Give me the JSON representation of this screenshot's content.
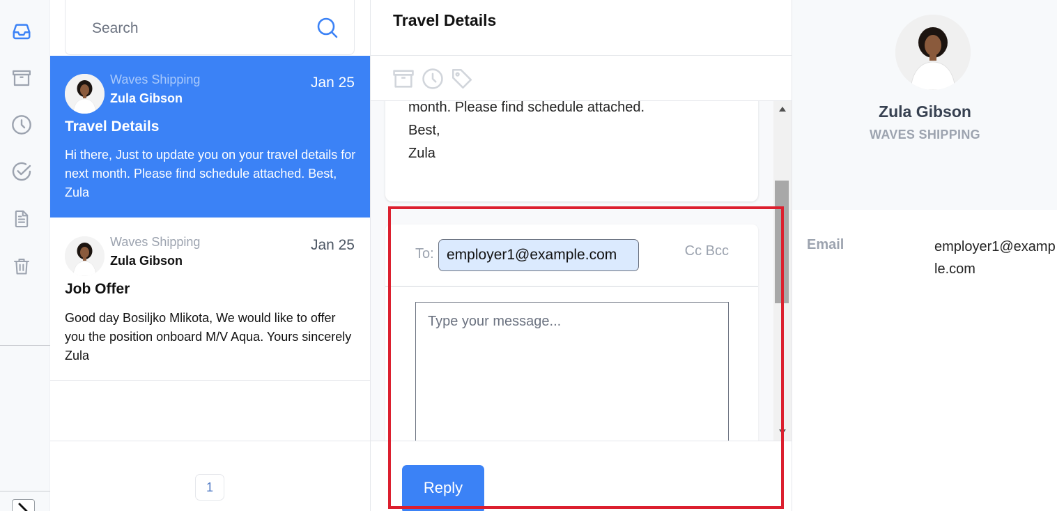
{
  "rail": {
    "items": [
      {
        "icon": "inbox-icon",
        "label": "Inbox",
        "active": true
      },
      {
        "icon": "archive-icon",
        "label": "Archive",
        "active": false
      },
      {
        "icon": "clock-icon",
        "label": "Snoozed",
        "active": false
      },
      {
        "icon": "check-circle-icon",
        "label": "Done",
        "active": false
      },
      {
        "icon": "document-icon",
        "label": "Drafts",
        "active": false
      },
      {
        "icon": "trash-icon",
        "label": "Trash",
        "active": false
      }
    ],
    "toggle_icon": "expand-arrow-icon"
  },
  "search": {
    "placeholder": "Search",
    "value": ""
  },
  "emails": [
    {
      "company": "Waves Shipping",
      "sender": "Zula Gibson",
      "date": "Jan 25",
      "subject": "Travel Details",
      "preview": "Hi there, Just to update you on your travel details for next month. Please find schedule attached. Best, Zula",
      "selected": true
    },
    {
      "company": "Waves Shipping",
      "sender": "Zula Gibson",
      "date": "Jan 25",
      "subject": "Job Offer",
      "preview": "Good day Bosiljko Mlikota, We would like to offer you the position onboard M/V Aqua. Yours sincerely Zula",
      "selected": false
    }
  ],
  "pagination": {
    "current_page": "1"
  },
  "detail": {
    "title": "Travel Details",
    "actions": [
      "archive-icon",
      "clock-icon",
      "tag-icon"
    ],
    "message_lines": [
      "month. Please find schedule attached.",
      "Best,",
      "Zula"
    ]
  },
  "reply": {
    "to_label": "To:",
    "to_value": "employer1@example.com",
    "cc_bcc_label": "Cc Bcc",
    "message_placeholder": "Type your message...",
    "message_value": "",
    "button_label": "Reply"
  },
  "contact": {
    "name": "Zula Gibson",
    "company": "WAVES SHIPPING",
    "fields": [
      {
        "label": "Email",
        "value": "employer1@example.com"
      }
    ]
  },
  "colors": {
    "accent": "#3b82f6",
    "highlight": "#dc1f2e",
    "chip_bg": "#dbeafe"
  }
}
